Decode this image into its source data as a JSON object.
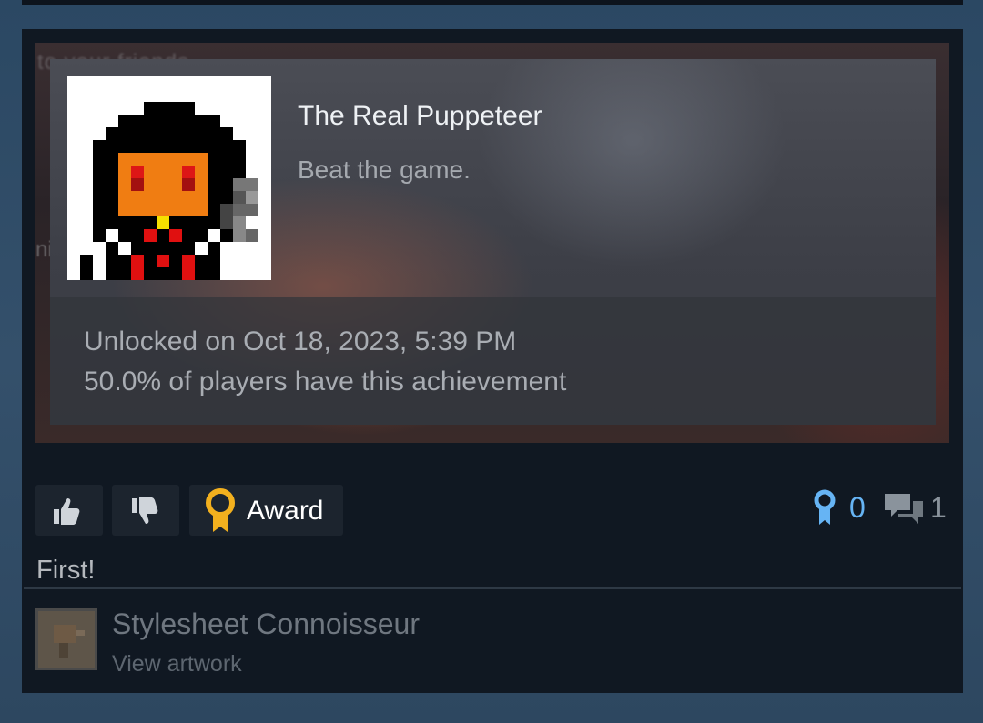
{
  "screenshot": {
    "background_text": "to your friends",
    "background_fragment": "ni"
  },
  "achievement": {
    "title": "The Real Puppeteer",
    "description": "Beat the game.",
    "unlocked": "Unlocked on Oct 18, 2023, 5:39 PM",
    "percent": "50.0% of players have this achievement",
    "icon": "puppeteer-pixel-icon"
  },
  "actions": {
    "thumbs_up_icon": "thumbs-up-icon",
    "thumbs_down_icon": "thumbs-down-icon",
    "award_label": "Award",
    "award_count": "0",
    "comment_count": "1"
  },
  "comment": {
    "text": "First!"
  },
  "author": {
    "name": "Stylesheet Connoisseur",
    "link": "View artwork"
  },
  "colors": {
    "award_gold": "#f2b01e",
    "award_blue": "#66b4f4",
    "card_bg": "#101822"
  }
}
